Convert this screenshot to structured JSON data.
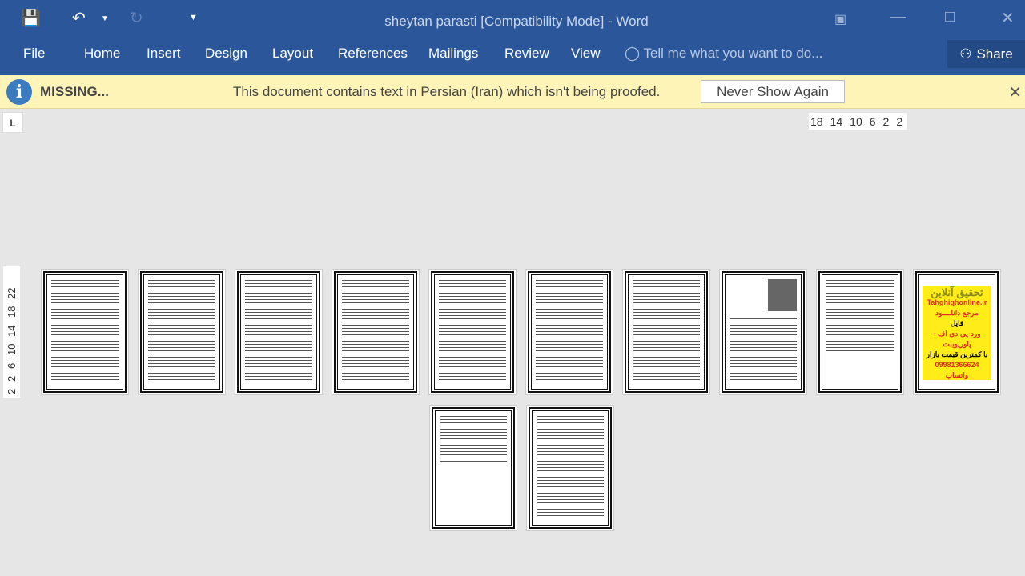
{
  "app": {
    "title": "sheytan parasti [Compatibility Mode] - Word",
    "accent": "#2b579a"
  },
  "qat": {
    "save": "save-icon",
    "undo": "undo-icon",
    "redo": "redo-icon",
    "customize": "customize-icon"
  },
  "ribbon": {
    "tabs": [
      "File",
      "Home",
      "Insert",
      "Design",
      "Layout",
      "References",
      "Mailings",
      "Review",
      "View"
    ],
    "tell_me": "Tell me what you want to do...",
    "share": "Share"
  },
  "message_bar": {
    "title": "MISSING...",
    "text": "This document contains text in Persian (Iran) which isn't being proofed.",
    "button": "Never Show Again",
    "color": "#fff4b8"
  },
  "tab_selector": "L",
  "h_ruler": [
    "18",
    "14",
    "10",
    "6",
    "2",
    "2"
  ],
  "v_ruler": [
    "2",
    "2",
    "6",
    "10",
    "14",
    "18",
    "22"
  ],
  "ad_page": {
    "lines": [
      "تحقیق آنلاین",
      "Tahghighonline.ir",
      "مرجع دانلــــود",
      "فایل",
      "ورد-پی دی اف - پاورپوینت",
      "با کمترین قیمت بازار",
      "09981366624 واتساپ"
    ]
  },
  "page_count": 12
}
